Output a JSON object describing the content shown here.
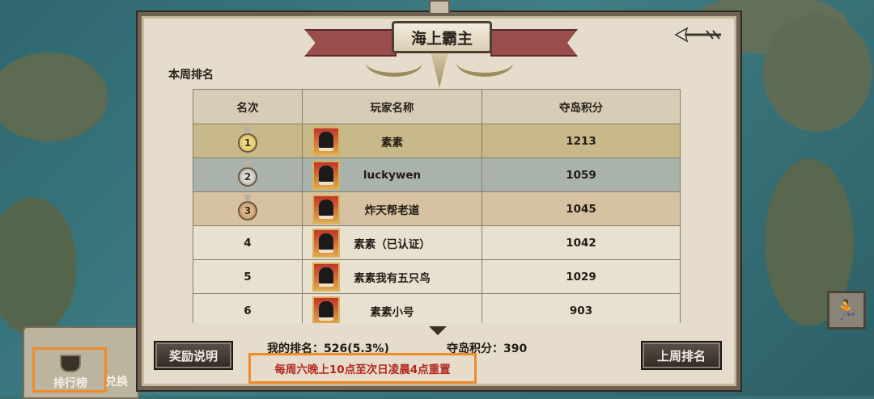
{
  "title": "海上霸主",
  "week_label": "本周排名",
  "table": {
    "headers": [
      "名次",
      "玩家名称",
      "夺岛积分"
    ],
    "rows": [
      {
        "rank": "1",
        "name": "素素",
        "score": "1213",
        "medal": "gold"
      },
      {
        "rank": "2",
        "name": "luckywen",
        "score": "1059",
        "medal": "silver"
      },
      {
        "rank": "3",
        "name": "炸天帮老道",
        "score": "1045",
        "medal": "bronze"
      },
      {
        "rank": "4",
        "name": "素素（已认证）",
        "score": "1042"
      },
      {
        "rank": "5",
        "name": "素素我有五只鸟",
        "score": "1029"
      },
      {
        "rank": "6",
        "name": "素素小号",
        "score": "903"
      }
    ]
  },
  "my_rank": "我的排名：526(5.3%)",
  "my_score": "夺岛积分：390",
  "buttons": {
    "reward_info": "奖励说明",
    "last_week": "上周排名"
  },
  "reset_note": "每周六晚上10点至次日凌晨4点重置",
  "bottom_tabs": {
    "leaderboard": "排行榜",
    "exchange": "兑换"
  },
  "colors": {
    "highlight_orange": "#f08a2a",
    "note_red": "#b3261e"
  }
}
